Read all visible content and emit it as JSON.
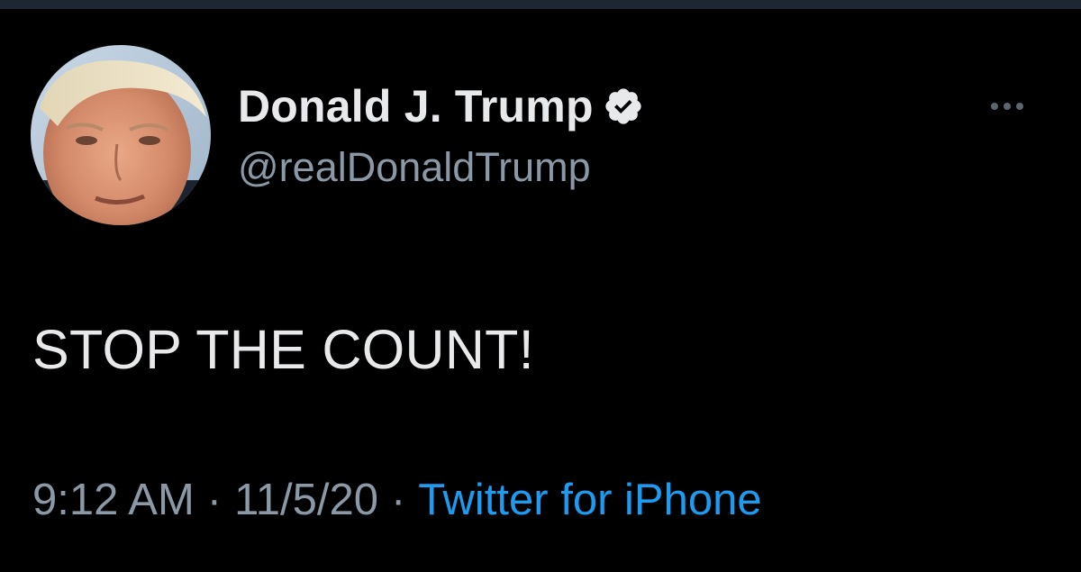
{
  "tweet": {
    "author": {
      "display_name": "Donald J. Trump",
      "handle": "@realDonaldTrump",
      "verified_icon": "verified-badge-icon"
    },
    "text": "STOP THE COUNT!",
    "time": "9:12 AM",
    "date": "11/5/20",
    "separator": "·",
    "source": "Twitter for iPhone",
    "more_icon": "more-options-icon"
  },
  "colors": {
    "background": "#000000",
    "primary_text": "#e7e9ea",
    "secondary_text": "#8b98a5",
    "link": "#1d9bf0"
  }
}
